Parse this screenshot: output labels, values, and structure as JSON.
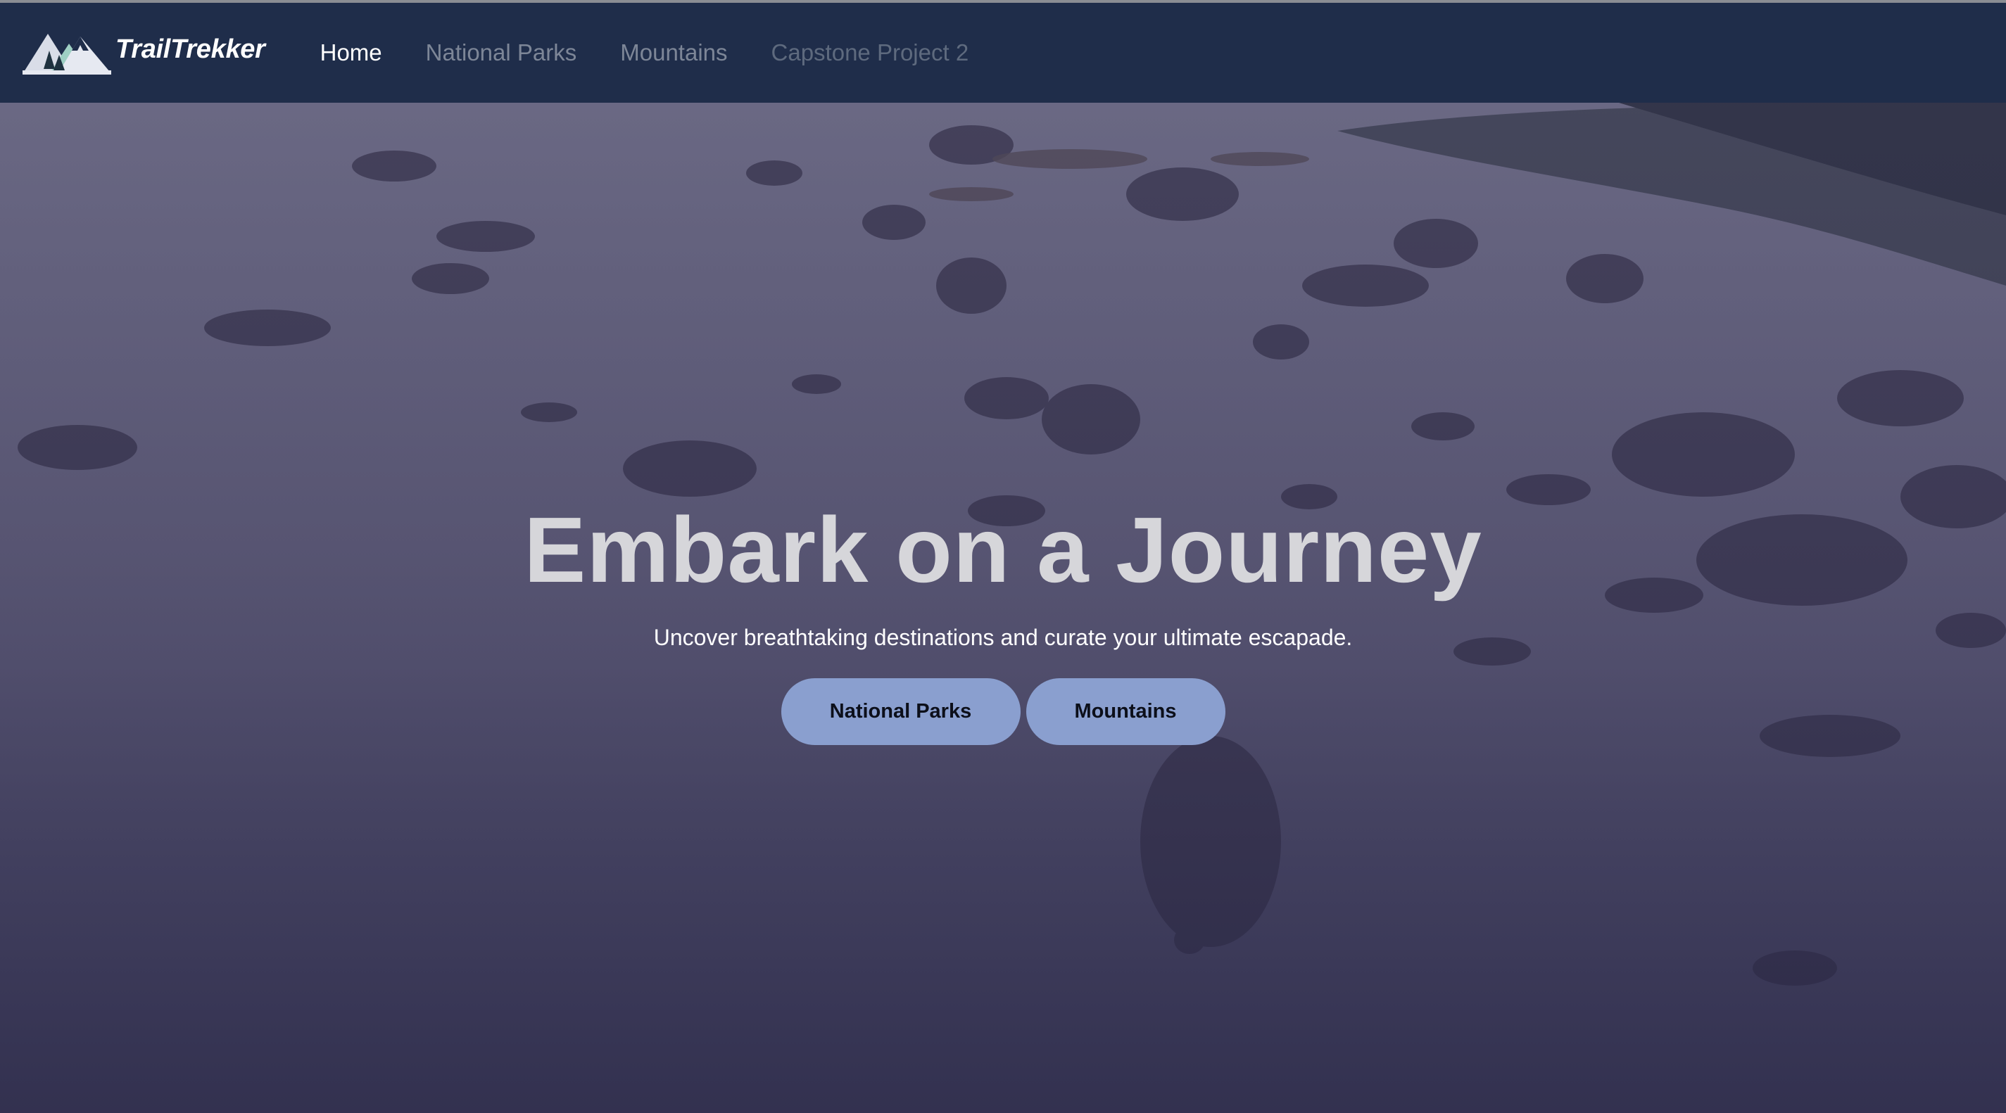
{
  "nav": {
    "brand": "TrailTrekker",
    "logo_icon": "mountain-trees-logo",
    "links": [
      {
        "label": "Home",
        "state": "active"
      },
      {
        "label": "National Parks",
        "state": "normal"
      },
      {
        "label": "Mountains",
        "state": "normal"
      },
      {
        "label": "Capstone Project 2",
        "state": "muted"
      }
    ]
  },
  "hero": {
    "title": "Embark on a Journey",
    "subtitle": "Uncover breathtaking destinations and curate your ultimate escapade.",
    "buttons": [
      {
        "label": "National Parks"
      },
      {
        "label": "Mountains"
      }
    ]
  },
  "colors": {
    "navbar_bg": "#1f2d4a",
    "button_bg": "#8a9fcf",
    "title_color": "#d6d6da",
    "overlay": "#2c284e"
  }
}
